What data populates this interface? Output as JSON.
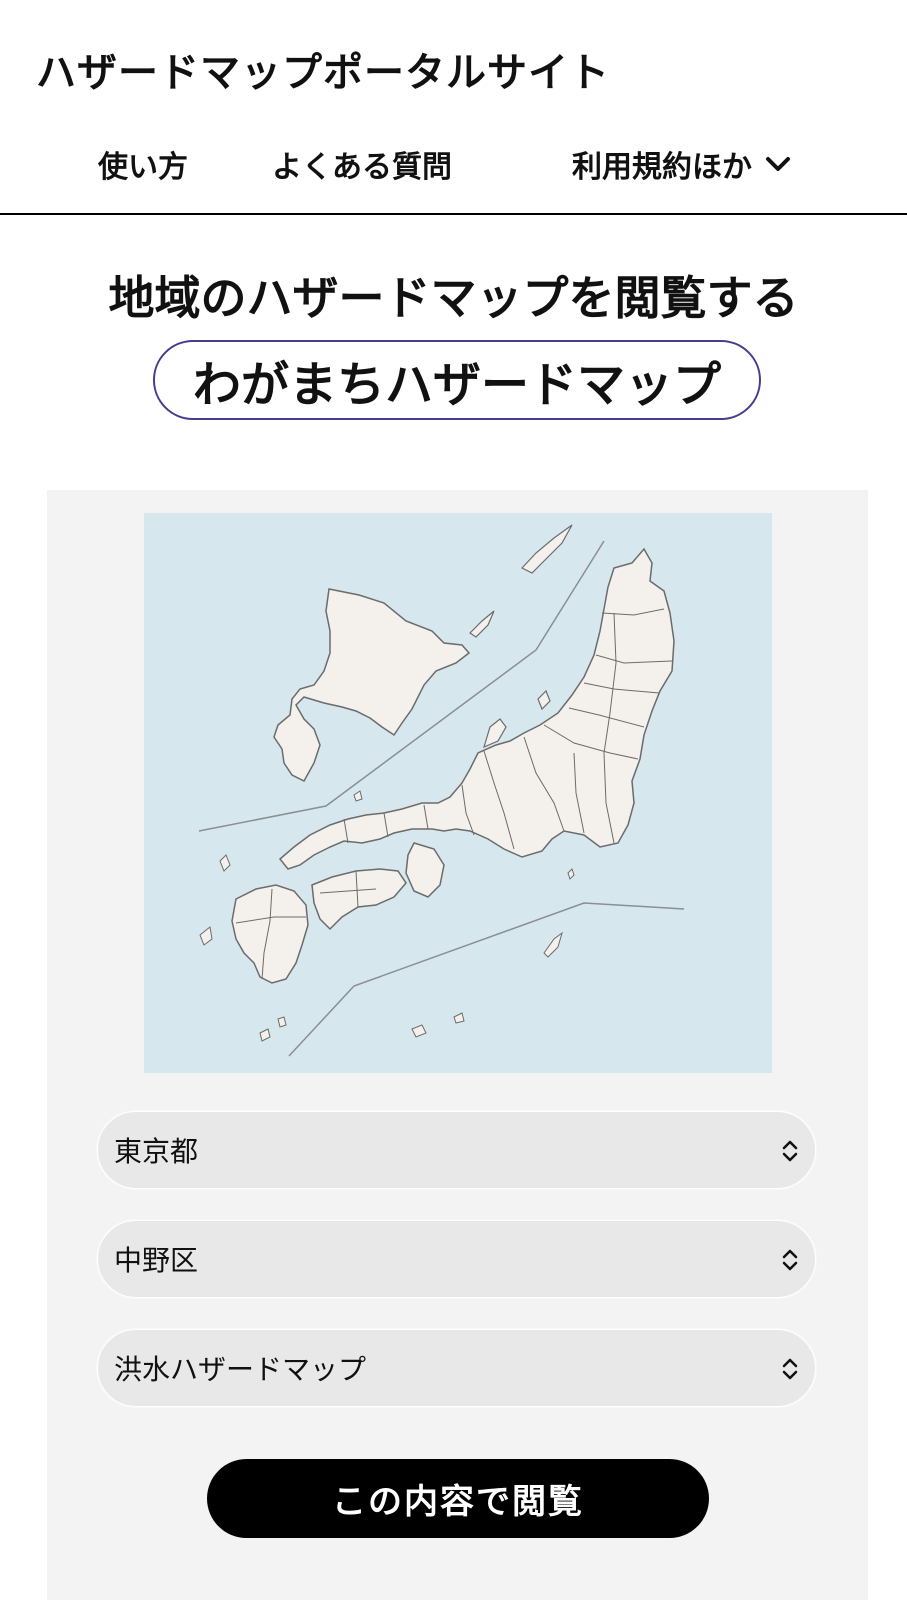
{
  "header": {
    "site_title": "ハザードマップポータルサイト",
    "nav": [
      {
        "label": "使い方"
      },
      {
        "label": "よくある質問"
      },
      {
        "label": "利用規約ほか",
        "icon": "chevron-down-icon"
      }
    ]
  },
  "main": {
    "headline": "地域のハザードマップを閲覧する",
    "pill_title": "わがまちハザードマップ",
    "map": {
      "icon": "japan-map",
      "colors": {
        "sea": "#d6e8ee",
        "land": "#f4f1ec",
        "border": "#6b6b6b"
      }
    },
    "selects": [
      {
        "value": "東京都",
        "icon": "updown-chevron-icon"
      },
      {
        "value": "中野区",
        "icon": "updown-chevron-icon"
      },
      {
        "value": "洪水ハザードマップ",
        "icon": "updown-chevron-icon"
      }
    ],
    "submit_label": "この内容で閲覧"
  },
  "colors": {
    "accent_border": "#4a3b8c",
    "button_bg": "#000000",
    "panel_bg": "#f3f3f3",
    "select_bg": "#e8e8e8"
  }
}
